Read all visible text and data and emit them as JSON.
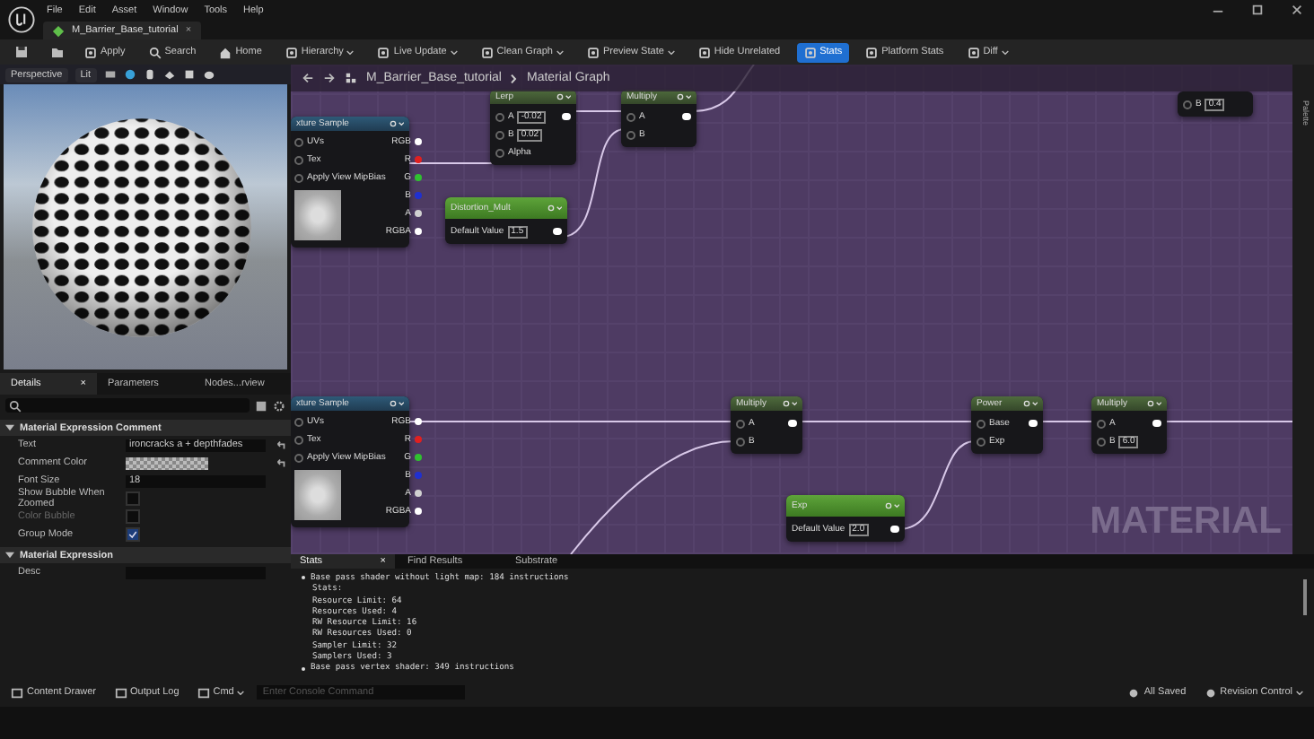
{
  "menu": [
    "File",
    "Edit",
    "Asset",
    "Window",
    "Tools",
    "Help"
  ],
  "document_tab": {
    "title": "M_Barrier_Base_tutorial",
    "close": "×"
  },
  "toolbar": [
    {
      "label": "Apply",
      "dropdown": false,
      "selected": false
    },
    {
      "label": "Search",
      "dropdown": false,
      "selected": false
    },
    {
      "label": "Home",
      "dropdown": false,
      "selected": false
    },
    {
      "label": "Hierarchy",
      "dropdown": true,
      "selected": false
    },
    {
      "label": "Live Update",
      "dropdown": true,
      "selected": false
    },
    {
      "label": "Clean Graph",
      "dropdown": true,
      "selected": false
    },
    {
      "label": "Preview State",
      "dropdown": true,
      "selected": false
    },
    {
      "label": "Hide Unrelated",
      "dropdown": false,
      "selected": false
    },
    {
      "label": "Stats",
      "dropdown": false,
      "selected": true
    },
    {
      "label": "Platform Stats",
      "dropdown": false,
      "selected": false
    },
    {
      "label": "Diff",
      "dropdown": true,
      "selected": false
    }
  ],
  "viewport": {
    "view_mode": "Perspective",
    "lighting": "Lit"
  },
  "details": {
    "tabs": [
      {
        "label": "Details",
        "selected": true,
        "close": "×"
      },
      {
        "label": "Parameters",
        "selected": false
      },
      {
        "label": "Nodes...rview",
        "selected": false
      }
    ],
    "sections": [
      {
        "title": "Material Expression Comment",
        "expanded": true,
        "rows": [
          {
            "kind": "text",
            "label": "Text",
            "value": "ironcracks a + depthfades",
            "resettable": true
          },
          {
            "kind": "color",
            "label": "Comment Color",
            "resettable": true
          },
          {
            "kind": "text",
            "label": "Font Size",
            "value": "18",
            "resettable": false
          },
          {
            "kind": "checkbox",
            "label": "Show Bubble When Zoomed",
            "checked": false,
            "disabled": false
          },
          {
            "kind": "checkbox",
            "label": "Color Bubble",
            "checked": false,
            "disabled": true
          },
          {
            "kind": "checkbox",
            "label": "Group Mode",
            "checked": true,
            "disabled": false
          }
        ]
      },
      {
        "title": "Material Expression",
        "expanded": true,
        "rows": [
          {
            "kind": "text",
            "label": "Desc",
            "value": "",
            "resettable": false
          }
        ]
      }
    ]
  },
  "graph": {
    "breadcrumb": [
      "M_Barrier_Base_tutorial",
      "Material Graph"
    ],
    "corner_label": "MATERIAL",
    "palette_label": "Palette",
    "nodes": [
      {
        "kind": "texture",
        "title": "xture Sample",
        "inputs": [
          {
            "label": "UVs"
          },
          {
            "label": "Tex"
          },
          {
            "label": "Apply View MipBias"
          }
        ],
        "outputs": [
          {
            "label": "RGB",
            "color": "#ffffff"
          },
          {
            "label": "R",
            "color": "#e02020"
          },
          {
            "label": "G",
            "color": "#30c030"
          },
          {
            "label": "B",
            "color": "#2030d0"
          },
          {
            "label": "A",
            "color": "#d0d0d0"
          },
          {
            "label": "RGBA",
            "color": "#ffffff"
          }
        ]
      },
      {
        "kind": "function",
        "title": "Lerp",
        "inputs": [
          {
            "label": "A",
            "value": "-0.02"
          },
          {
            "label": "B",
            "value": "0.02"
          },
          {
            "label": "Alpha"
          }
        ]
      },
      {
        "kind": "function",
        "title": "Multiply",
        "inputs": [
          {
            "label": "A"
          },
          {
            "label": "B"
          }
        ]
      },
      {
        "kind": "parameter",
        "title": "Distortion_Mult",
        "inputs": [
          {
            "label": "Default Value",
            "value": "1.5"
          }
        ]
      },
      {
        "kind": "fragment",
        "inputs": [
          {
            "label": "B",
            "value": "0.4"
          }
        ]
      },
      {
        "kind": "texture",
        "title": "xture Sample",
        "inputs": [
          {
            "label": "UVs"
          },
          {
            "label": "Tex"
          },
          {
            "label": "Apply View MipBias"
          }
        ],
        "outputs": [
          {
            "label": "RGB",
            "color": "#ffffff"
          },
          {
            "label": "R",
            "color": "#e02020"
          },
          {
            "label": "G",
            "color": "#30c030"
          },
          {
            "label": "B",
            "color": "#2030d0"
          },
          {
            "label": "A",
            "color": "#d0d0d0"
          },
          {
            "label": "RGBA",
            "color": "#ffffff"
          }
        ]
      },
      {
        "kind": "function",
        "title": "Multiply",
        "inputs": [
          {
            "label": "A"
          },
          {
            "label": "B"
          }
        ]
      },
      {
        "kind": "function",
        "title": "Power",
        "inputs": [
          {
            "label": "Base"
          },
          {
            "label": "Exp"
          }
        ]
      },
      {
        "kind": "function",
        "title": "Multiply",
        "inputs": [
          {
            "label": "A"
          },
          {
            "label": "B",
            "value": "6.0"
          }
        ]
      },
      {
        "kind": "parameter",
        "title": "Exp",
        "inputs": [
          {
            "label": "Default Value",
            "value": "2.0"
          }
        ]
      }
    ]
  },
  "stats_panel": {
    "tabs": [
      {
        "label": "Stats",
        "selected": true,
        "close": "×"
      },
      {
        "label": "Find Results",
        "selected": false
      },
      {
        "label": "Substrate",
        "selected": false
      }
    ],
    "lines": [
      {
        "kind": "bullet",
        "text": "Base pass shader without light map: 184 instructions"
      },
      {
        "kind": "detail",
        "text": "Stats:"
      },
      {
        "kind": "detail",
        "text": "Resource Limit: 64"
      },
      {
        "kind": "detail",
        "text": "Resources Used: 4"
      },
      {
        "kind": "detail",
        "text": "RW Resource Limit: 16"
      },
      {
        "kind": "detail",
        "text": "RW Resources Used: 0"
      },
      {
        "kind": "detail",
        "text": "Sampler Limit: 32"
      },
      {
        "kind": "detail",
        "text": "Samplers Used: 3"
      },
      {
        "kind": "bullet",
        "text": "Base pass vertex shader: 349 instructions"
      }
    ]
  },
  "status_bar": {
    "left": [
      {
        "label": "Content Drawer",
        "dropdown": false
      },
      {
        "label": "Output Log",
        "dropdown": false
      },
      {
        "label": "Cmd",
        "dropdown": true
      }
    ],
    "console": {
      "placeholder": "Enter Console Command"
    },
    "right": [
      {
        "label": "All Saved",
        "dropdown": false
      },
      {
        "label": "Revision Control",
        "dropdown": true
      }
    ]
  }
}
